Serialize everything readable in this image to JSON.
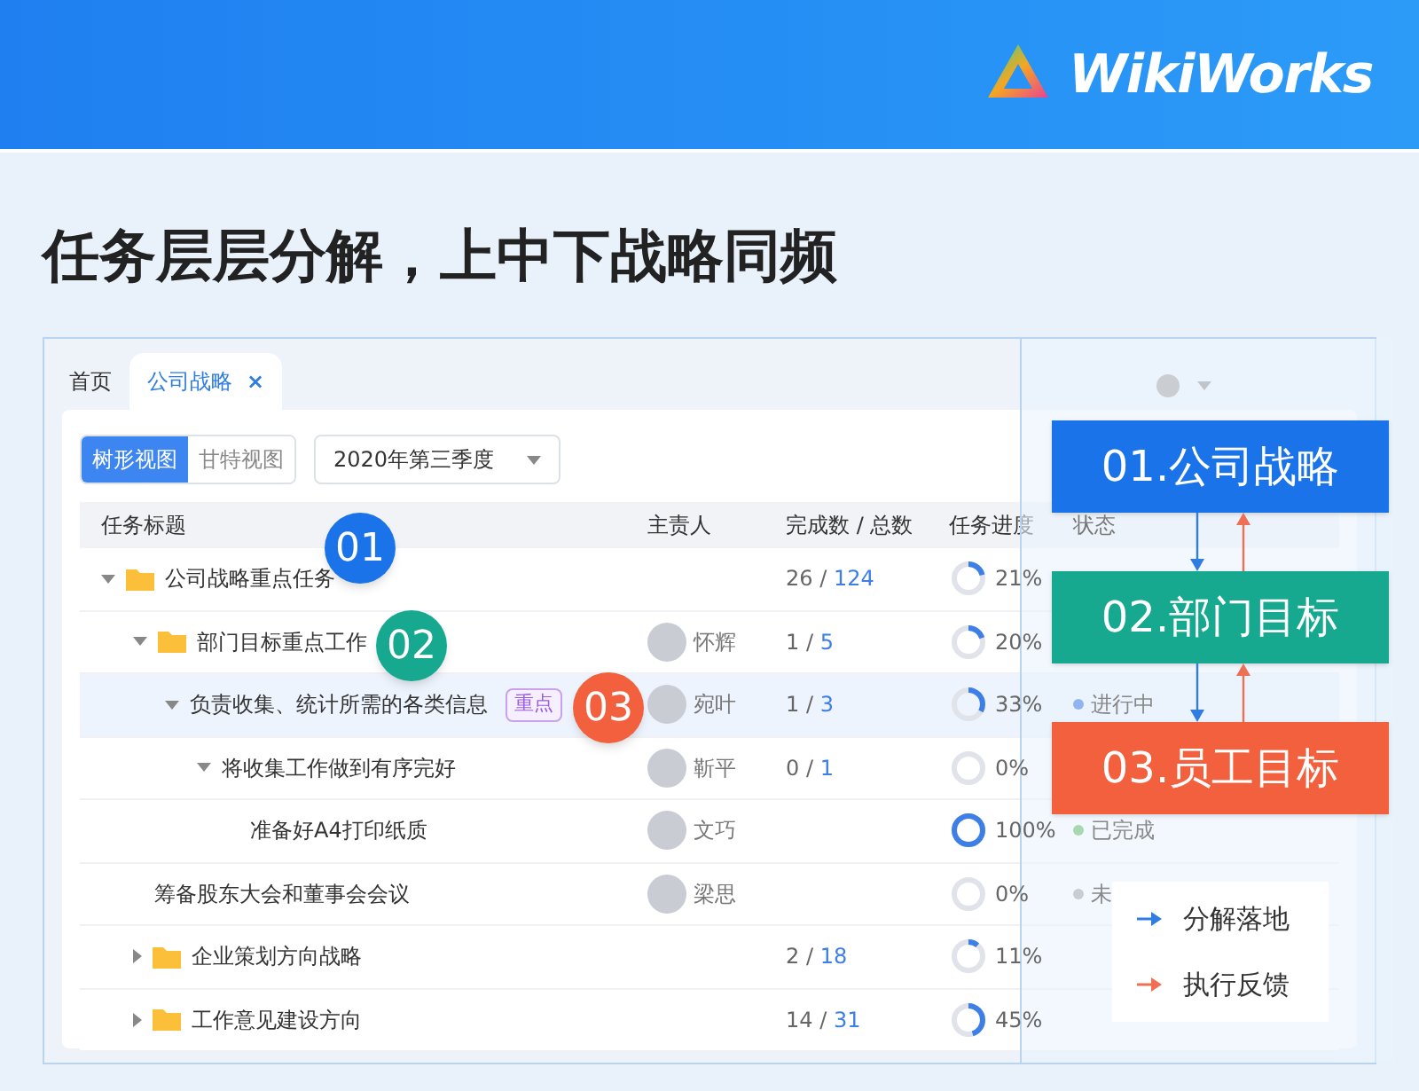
{
  "header": {
    "logo_text": "WikiWorks"
  },
  "headline": "任务层层分解，上中下战略同频",
  "app": {
    "tabs": [
      {
        "label": "首页",
        "selected": false
      },
      {
        "label": "公司战略",
        "selected": true,
        "close": "×"
      }
    ],
    "views": [
      {
        "label": "树形视图",
        "selected": true
      },
      {
        "label": "甘特视图",
        "selected": false
      }
    ],
    "period_select": {
      "value": "2020年第三季度"
    },
    "columns": [
      "任务标题",
      "主责人",
      "完成数 / 总数",
      "任务进度",
      "状态"
    ],
    "rows": [
      {
        "title": "公司战略重点任务",
        "folder": true,
        "expanded": true,
        "selected": false,
        "done": "26",
        "sep": "/",
        "total": "124",
        "level": 0.21,
        "percent": "21%",
        "children": [
          {
            "title": "部门目标重点工作",
            "folder": true,
            "expanded": true,
            "selected": false,
            "owner": "怀辉",
            "done": "1",
            "sep": "/",
            "total": "5",
            "level": 0.2,
            "percent": "20%",
            "children": [
              {
                "title": "负责收集、统计所需的各类信息",
                "folder": false,
                "expanded": true,
                "selected": true,
                "tag": "重点",
                "owner": "宛叶",
                "done": "1",
                "sep": "/",
                "total": "3",
                "level": 0.33,
                "percent": "33%",
                "status": {
                  "label": "进行中",
                  "color": "#8fb4f0"
                },
                "children": [
                  {
                    "title": "将收集工作做到有序完好",
                    "folder": false,
                    "expanded": true,
                    "selected": false,
                    "owner": "靳平",
                    "done": "0",
                    "sep": "/",
                    "total": "1",
                    "level": 0,
                    "percent": "0%",
                    "children": [
                      {
                        "title": "准备好A4打印纸质",
                        "folder": false,
                        "selected": false,
                        "owner": "文巧",
                        "level": 1,
                        "percent": "100%",
                        "status": {
                          "label": "已完成",
                          "color": "#a8d8b0"
                        }
                      }
                    ]
                  }
                ]
              }
            ]
          },
          {
            "title": "筹备股东大会和董事会会议",
            "folder": false,
            "selected": false,
            "owner": "梁思",
            "level": 0,
            "percent": "0%",
            "status": {
              "label": "未",
              "color": "#c8ccd4"
            }
          },
          {
            "title": "企业策划方向战略",
            "folder": true,
            "expanded": false,
            "selected": false,
            "done": "2",
            "sep": "/",
            "total": "18",
            "level": 0.11,
            "percent": "11%"
          },
          {
            "title": "工作意见建设方向",
            "folder": true,
            "expanded": false,
            "selected": false,
            "done": "14",
            "sep": "/",
            "total": "31",
            "level": 0.45,
            "percent": "45%"
          }
        ]
      }
    ]
  },
  "callouts": [
    {
      "label": "01",
      "color": "#1a73e8"
    },
    {
      "label": "02",
      "color": "#17a98f"
    },
    {
      "label": "03",
      "color": "#f2603e"
    }
  ],
  "stages": [
    {
      "label": "01.公司战略",
      "color": "#1a73e8"
    },
    {
      "label": "02.部门目标",
      "color": "#17a98f"
    },
    {
      "label": "03.员工目标",
      "color": "#f2603e"
    }
  ],
  "legend": [
    {
      "label": "分解落地",
      "color": "#2f7de1"
    },
    {
      "label": "执行反馈",
      "color": "#ef6f55"
    }
  ]
}
